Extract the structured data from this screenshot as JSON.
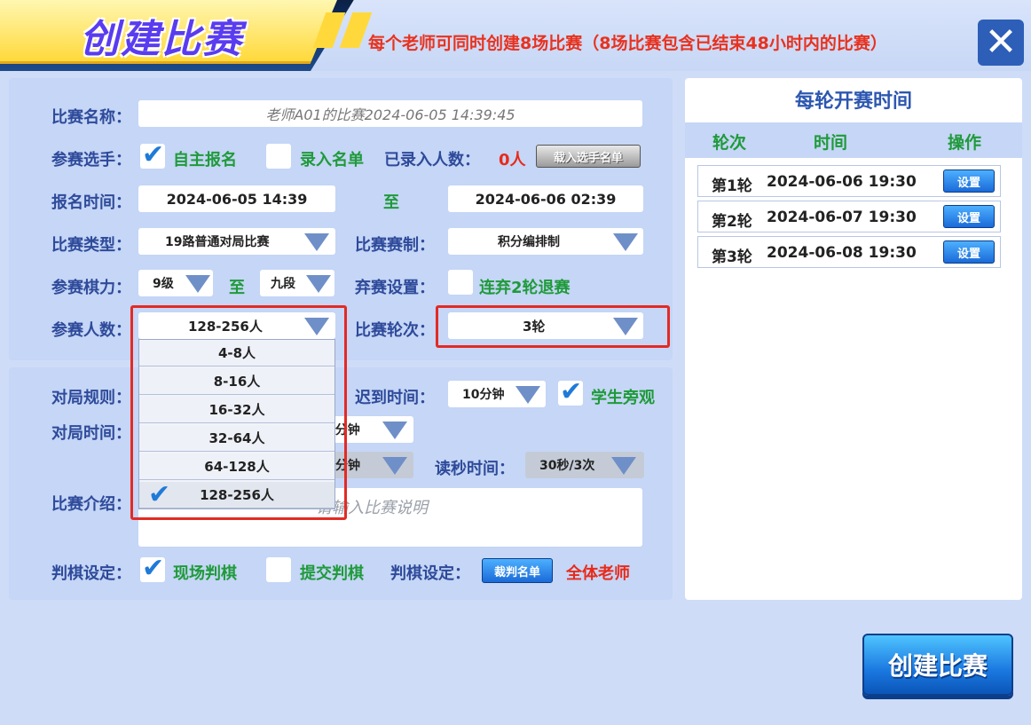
{
  "header": {
    "title": "创建比赛",
    "notice": "每个老师可同时创建8场比赛（8场比赛包含已结束48小时内的比赛）",
    "close_label": "✕"
  },
  "form": {
    "name_label": "比赛名称：",
    "name_value": "老师A01的比赛2024-06-05 14:39:45",
    "players_label": "参赛选手：",
    "self_signup_label": "自主报名",
    "self_signup_checked": true,
    "entry_list_label": "录入名单",
    "entry_list_checked": false,
    "entered_count_label": "已录入人数：",
    "entered_count_value": "0人",
    "load_players_button": "载入选手名单",
    "signup_time_label": "报名时间：",
    "signup_start": "2024-06-05 14:39",
    "to_label": "至",
    "signup_end": "2024-06-06 02:39",
    "match_type_label": "比赛类型：",
    "match_type_value": "19路普通对局比赛",
    "system_label": "比赛赛制：",
    "system_value": "积分编排制",
    "level_label": "参赛棋力：",
    "level_min": "9级",
    "level_max": "九段",
    "forfeit_label": "弃赛设置：",
    "forfeit_option": "连弃2轮退赛",
    "count_label": "参赛人数：",
    "count_value": "128-256人",
    "rounds_label": "比赛轮次：",
    "rounds_value": "3轮",
    "count_options": [
      "4-8人",
      "8-16人",
      "16-32人",
      "32-64人",
      "64-128人",
      "128-256人"
    ],
    "count_selected": "128-256人",
    "rules_label": "对局规则：",
    "late_label": "迟到时间：",
    "late_value": "10分钟",
    "spectate_label": "学生旁观",
    "game_time_label": "对局时间：",
    "game_time_value": "0分钟",
    "game_time_value2": "分钟",
    "byoyomi_label": "读秒时间：",
    "byoyomi_value": "30秒/3次",
    "intro_label": "比赛介绍：",
    "intro_placeholder": "请输入比赛说明",
    "judge_label": "判棋设定：",
    "onsite_judge": "现场判棋",
    "submit_judge": "提交判棋",
    "judge_setting_label": "判棋设定：",
    "referee_button": "裁判名单",
    "judge_scope": "全体老师"
  },
  "schedule": {
    "title": "每轮开赛时间",
    "col_round": "轮次",
    "col_time": "时间",
    "col_action": "操作",
    "rows": [
      {
        "round": "第1轮",
        "time": "2024-06-06 19:30",
        "action": "设置"
      },
      {
        "round": "第2轮",
        "time": "2024-06-07 19:30",
        "action": "设置"
      },
      {
        "round": "第3轮",
        "time": "2024-06-08 19:30",
        "action": "设置"
      }
    ]
  },
  "footer": {
    "create_button": "创建比赛"
  }
}
